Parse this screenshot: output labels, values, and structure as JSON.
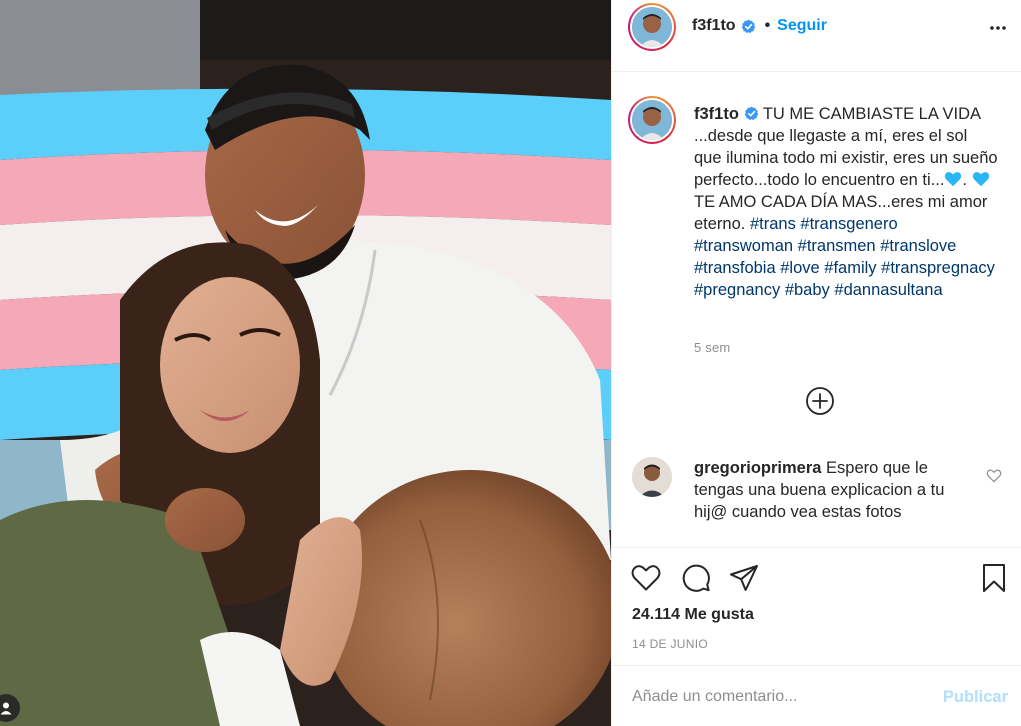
{
  "post": {
    "username": "f3f1to",
    "separator": "•",
    "follow_label": "Seguir",
    "more_icon": "more-options-icon"
  },
  "caption": {
    "username": "f3f1to",
    "line1": "TU ME CAMBIASTE LA VIDA ...desde que llegaste a mí, eres el sol que ilumina todo mi existir, eres un sueño perfecto...todo lo encuentro en ti...",
    "mid1": ".",
    "line2": "TE AMO CADA DÍA MAS...eres mi amor eterno.",
    "hashtags": [
      "#trans",
      "#transgenero",
      "#transwoman",
      "#transmen",
      "#translove",
      "#transfobia",
      "#love",
      "#family",
      "#transpregnacy",
      "#pregnancy",
      "#baby",
      "#dannasultana"
    ],
    "time": "5 sem",
    "heart_color": "#29b6f6"
  },
  "comment": {
    "username": "gregorioprimera",
    "text": "Espero que le tengas una buena explicacion a tu hij@ cuando vea estas fotos"
  },
  "actions": {
    "likes": "24.114 Me gusta",
    "date": "14 DE JUNIO"
  },
  "add_comment": {
    "placeholder": "Añade un comentario...",
    "publish_label": "Publicar"
  },
  "colors": {
    "accent": "#0095f6",
    "link": "#00376b",
    "muted": "#8e8e8e",
    "publish_disabled": "#b2dffc",
    "flag_blue": "#5bcefa",
    "flag_pink": "#f5a9b8"
  }
}
